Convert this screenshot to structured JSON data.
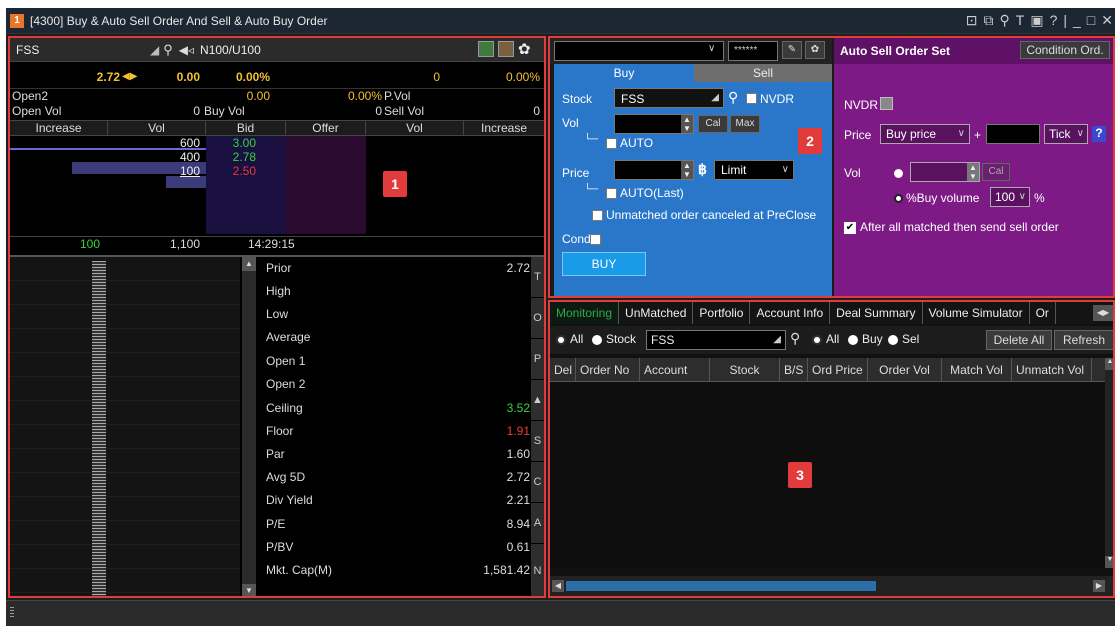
{
  "window": {
    "number": "1",
    "title": "[4300] Buy & Auto Sell Order And Sell & Auto Buy Order"
  },
  "quote": {
    "symbol": "FSS",
    "market": "N100/U100",
    "last": "2.72",
    "change": "0.00",
    "change_pct": "0.00%",
    "vol_right": "0",
    "pct_right": "0.00%",
    "open2_label": "Open2",
    "open2_val": "0.00",
    "open2_pct": "0.00%",
    "pvol_label": "P.Vol",
    "openvol_label": "Open Vol",
    "openvol_val": "0",
    "buyvol_label": "Buy Vol",
    "sellvol_val": "0",
    "sellvol_label": "Sell Vol",
    "sellvol_right": "0",
    "headers": [
      "Increase",
      "Vol",
      "Bid",
      "Offer",
      "Vol",
      "Increase"
    ],
    "bids": [
      {
        "vol": "600",
        "price": "3.00"
      },
      {
        "vol": "400",
        "price": "2.78"
      },
      {
        "vol": "100",
        "price": "2.50"
      }
    ],
    "footer": {
      "left": "100",
      "vol": "1,100",
      "time": "14:29:15"
    },
    "stats": [
      {
        "name": "Prior",
        "value": "2.72"
      },
      {
        "name": "High",
        "value": ""
      },
      {
        "name": "Low",
        "value": ""
      },
      {
        "name": "Average",
        "value": ""
      },
      {
        "name": "Open 1",
        "value": ""
      },
      {
        "name": "Open 2",
        "value": ""
      },
      {
        "name": "Ceiling",
        "value": "3.52"
      },
      {
        "name": "Floor",
        "value": "1.91"
      },
      {
        "name": "Par",
        "value": "1.60"
      },
      {
        "name": "Avg 5D",
        "value": "2.72"
      },
      {
        "name": "Div Yield",
        "value": "2.21"
      },
      {
        "name": "P/E",
        "value": "8.94"
      },
      {
        "name": "P/BV",
        "value": "0.61"
      },
      {
        "name": "Mkt. Cap(M)",
        "value": "1,581.42"
      }
    ],
    "side_tabs": [
      "T",
      "O",
      "P",
      "▲",
      "S",
      "C",
      "A",
      "N"
    ],
    "badge": "1"
  },
  "order": {
    "password_mask": "******",
    "tab_buy": "Buy",
    "tab_sell": "Sell",
    "stock_label": "Stock",
    "stock_value": "FSS",
    "nvdr_label": "NVDR",
    "vol_label": "Vol",
    "cal_label": "Cal",
    "max_label": "Max",
    "auto_label": "AUTO",
    "price_label": "Price",
    "price_type": "Limit",
    "auto_last_label": "AUTO(Last)",
    "unmatched_label": "Unmatched order canceled at PreClose",
    "cond_label": "Cond",
    "buy_button": "BUY",
    "badge": "2"
  },
  "autosell": {
    "title": "Auto Sell Order Set",
    "condition_btn": "Condition Ord.",
    "nvdr_label": "NVDR",
    "price_label": "Price",
    "price_option": "Buy price",
    "plus": "+",
    "tick_label": "Tick",
    "help": "?",
    "vol_label": "Vol",
    "cal_label": "Cal",
    "pct_label": "%Buy volume",
    "pct_value": "100",
    "pct_sign": "%",
    "after_label": "After all matched then send sell order"
  },
  "monitor": {
    "tabs": [
      "Monitoring",
      "UnMatched",
      "Portfolio",
      "Account Info",
      "Deal Summary",
      "Volume Simulator",
      "Or"
    ],
    "filter_all": "All",
    "filter_stock": "Stock",
    "stock_value": "FSS",
    "side_all": "All",
    "side_buy": "Buy",
    "side_sell": "Sel",
    "delete_all": "Delete All",
    "refresh": "Refresh",
    "columns": [
      "Del",
      "Order No",
      "Account",
      "Stock",
      "B/S",
      "Ord Price",
      "Order Vol",
      "Match Vol",
      "Unmatch Vol"
    ],
    "badge": "3"
  },
  "colors": {
    "accent_red": "#e23b3b",
    "buy_blue": "#2a77c9",
    "autosell_purple": "#7d1a86",
    "positive": "#36d33a",
    "negative": "#e83a3a",
    "title_orange": "#e8762a"
  }
}
